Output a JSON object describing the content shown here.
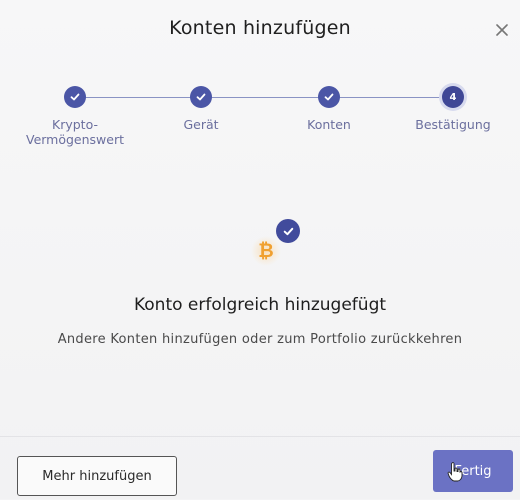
{
  "dialog": {
    "title": "Konten hinzufügen",
    "close_icon": "close-icon"
  },
  "stepper": {
    "steps": [
      {
        "label": "Krypto-\nVermögenswert",
        "state": "done",
        "icon": "check-icon"
      },
      {
        "label": "Gerät",
        "state": "done",
        "icon": "check-icon"
      },
      {
        "label": "Konten",
        "state": "done",
        "icon": "check-icon"
      },
      {
        "label": "Bestätigung",
        "state": "current",
        "number": "4"
      }
    ]
  },
  "result": {
    "coin_icon": "bitcoin-icon",
    "badge_icon": "check-icon",
    "headline": "Konto erfolgreich hinzugefügt",
    "subline": "Andere Konten hinzufügen oder zum Portfolio zurückkehren"
  },
  "footer": {
    "secondary_label": "Mehr hinzufügen",
    "primary_label": "Fertig"
  },
  "colors": {
    "accent": "#4b56a6",
    "primary_button": "#6b72c4",
    "coin": "#f0a030"
  }
}
